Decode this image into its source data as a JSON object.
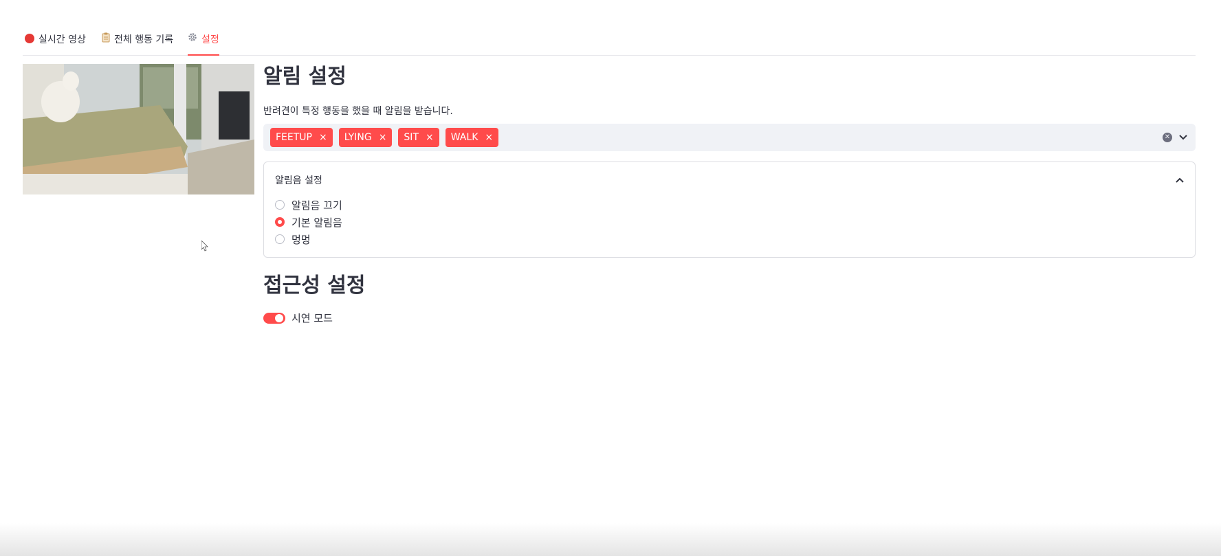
{
  "tabs": [
    {
      "label": "실시간 영상",
      "icon": "red-circle-icon"
    },
    {
      "label": "전체 행동 기록",
      "icon": "clipboard-icon"
    },
    {
      "label": "설정",
      "icon": "gear-icon",
      "active": true
    }
  ],
  "alert_settings": {
    "title": "알림 설정",
    "caption": "반려견이 특정 행동을 했을 때 알림을 받습니다.",
    "selected_behaviors": [
      "FEETUP",
      "LYING",
      "SIT",
      "WALK"
    ],
    "remove_glyph": "×"
  },
  "sound_settings": {
    "header": "알림음 설정",
    "options": [
      "알림음 끄기",
      "기본 알림음",
      "멍멍"
    ],
    "selected": "기본 알림음"
  },
  "accessibility": {
    "title": "접근성 설정",
    "demo_mode_label": "시연 모드",
    "demo_mode_on": true
  },
  "colors": {
    "accent": "#ff4b4b",
    "text": "#31333f",
    "input_bg": "#f0f2f6"
  }
}
